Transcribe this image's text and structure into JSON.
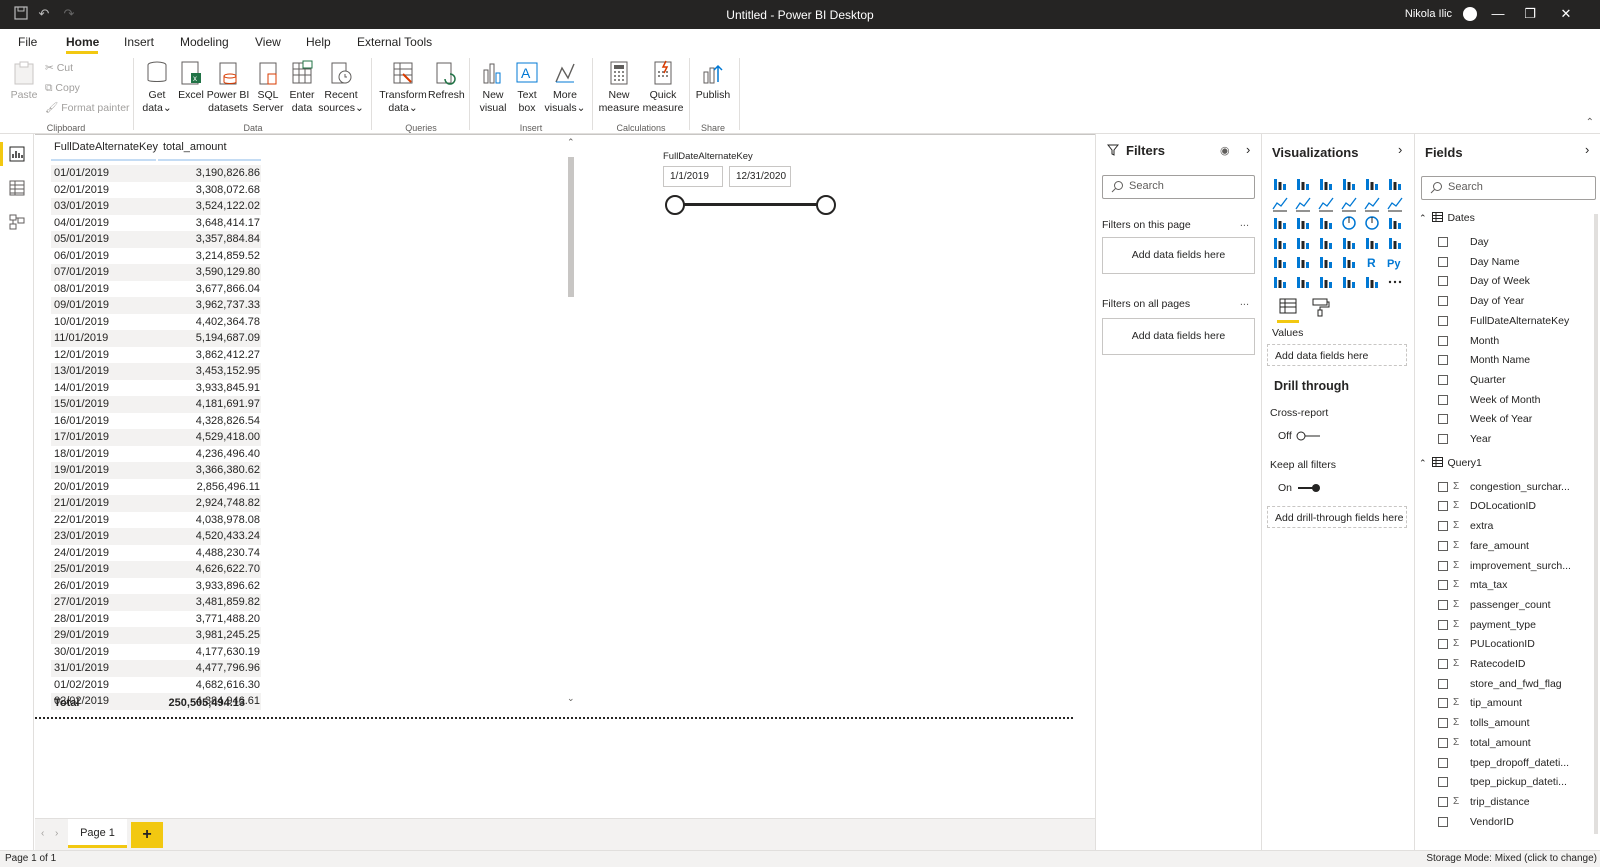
{
  "window": {
    "title": "Untitled - Power BI Desktop",
    "user": "Nikola Ilic"
  },
  "menu": {
    "items": [
      "File",
      "Home",
      "Insert",
      "Modeling",
      "View",
      "Help",
      "External Tools"
    ],
    "active": "Home"
  },
  "ribbon": {
    "clipboard": {
      "paste": "Paste",
      "cut": "Cut",
      "copy": "Copy",
      "format_painter": "Format painter",
      "label": "Clipboard"
    },
    "data": {
      "get_data_1": "Get",
      "get_data_2": "data",
      "excel": "Excel",
      "pbi_1": "Power BI",
      "pbi_2": "datasets",
      "sql_1": "SQL",
      "sql_2": "Server",
      "enter_1": "Enter",
      "enter_2": "data",
      "recent_1": "Recent",
      "recent_2": "sources",
      "label": "Data"
    },
    "queries": {
      "transform_1": "Transform",
      "transform_2": "data",
      "refresh": "Refresh",
      "label": "Queries"
    },
    "insert": {
      "new_visual_1": "New",
      "new_visual_2": "visual",
      "text_box_1": "Text",
      "text_box_2": "box",
      "more_1": "More",
      "more_2": "visuals",
      "label": "Insert"
    },
    "calculations": {
      "new_measure_1": "New",
      "new_measure_2": "measure",
      "quick_measure_1": "Quick",
      "quick_measure_2": "measure",
      "label": "Calculations"
    },
    "share": {
      "publish": "Publish",
      "label": "Share"
    }
  },
  "table": {
    "headers": [
      "FullDateAlternateKey",
      "total_amount"
    ],
    "rows": [
      [
        "01/01/2019",
        "3,190,826.86"
      ],
      [
        "02/01/2019",
        "3,308,072.68"
      ],
      [
        "03/01/2019",
        "3,524,122.02"
      ],
      [
        "04/01/2019",
        "3,648,414.17"
      ],
      [
        "05/01/2019",
        "3,357,884.84"
      ],
      [
        "06/01/2019",
        "3,214,859.52"
      ],
      [
        "07/01/2019",
        "3,590,129.80"
      ],
      [
        "08/01/2019",
        "3,677,866.04"
      ],
      [
        "09/01/2019",
        "3,962,737.33"
      ],
      [
        "10/01/2019",
        "4,402,364.78"
      ],
      [
        "11/01/2019",
        "5,194,687.09"
      ],
      [
        "12/01/2019",
        "3,862,412.27"
      ],
      [
        "13/01/2019",
        "3,453,152.95"
      ],
      [
        "14/01/2019",
        "3,933,845.91"
      ],
      [
        "15/01/2019",
        "4,181,691.97"
      ],
      [
        "16/01/2019",
        "4,328,826.54"
      ],
      [
        "17/01/2019",
        "4,529,418.00"
      ],
      [
        "18/01/2019",
        "4,236,496.40"
      ],
      [
        "19/01/2019",
        "3,366,380.62"
      ],
      [
        "20/01/2019",
        "2,856,496.11"
      ],
      [
        "21/01/2019",
        "2,924,748.82"
      ],
      [
        "22/01/2019",
        "4,038,978.08"
      ],
      [
        "23/01/2019",
        "4,520,433.24"
      ],
      [
        "24/01/2019",
        "4,488,230.74"
      ],
      [
        "25/01/2019",
        "4,626,622.70"
      ],
      [
        "26/01/2019",
        "3,933,896.62"
      ],
      [
        "27/01/2019",
        "3,481,859.82"
      ],
      [
        "28/01/2019",
        "3,771,488.20"
      ],
      [
        "29/01/2019",
        "3,981,245.25"
      ],
      [
        "30/01/2019",
        "4,177,630.19"
      ],
      [
        "31/01/2019",
        "4,477,796.96"
      ],
      [
        "01/02/2019",
        "4,682,616.30"
      ],
      [
        "02/02/2019",
        "4,384,946.61"
      ]
    ],
    "total_label": "Total",
    "total_value": "250,505,494.13"
  },
  "slicer": {
    "title": "FullDateAlternateKey",
    "start": "1/1/2019",
    "end": "12/31/2020"
  },
  "pages": {
    "tab": "Page 1",
    "add": "+"
  },
  "status": {
    "left": "Page 1 of 1",
    "right": "Storage Mode: Mixed (click to change)"
  },
  "filters": {
    "title": "Filters",
    "search_placeholder": "Search",
    "on_this_page": "Filters on this page",
    "on_all_pages": "Filters on all pages",
    "add_fields": "Add data fields here",
    "more": "..."
  },
  "visualizations": {
    "title": "Visualizations",
    "values_label": "Values",
    "values_drop": "Add data fields here",
    "drill_title": "Drill through",
    "cross_report": "Cross-report",
    "cross_state": "Off",
    "keep_filters": "Keep all filters",
    "keep_state": "On",
    "drill_drop": "Add drill-through fields here",
    "more": "..."
  },
  "fields": {
    "title": "Fields",
    "search_placeholder": "Search",
    "tables": [
      {
        "name": "Dates",
        "fields": [
          {
            "name": "Day",
            "sigma": false
          },
          {
            "name": "Day Name",
            "sigma": false
          },
          {
            "name": "Day of Week",
            "sigma": false
          },
          {
            "name": "Day of Year",
            "sigma": false
          },
          {
            "name": "FullDateAlternateKey",
            "sigma": false
          },
          {
            "name": "Month",
            "sigma": false
          },
          {
            "name": "Month Name",
            "sigma": false
          },
          {
            "name": "Quarter",
            "sigma": false
          },
          {
            "name": "Week of Month",
            "sigma": false
          },
          {
            "name": "Week of Year",
            "sigma": false
          },
          {
            "name": "Year",
            "sigma": false
          }
        ]
      },
      {
        "name": "Query1",
        "fields": [
          {
            "name": "congestion_surchar...",
            "sigma": true
          },
          {
            "name": "DOLocationID",
            "sigma": true
          },
          {
            "name": "extra",
            "sigma": true
          },
          {
            "name": "fare_amount",
            "sigma": true
          },
          {
            "name": "improvement_surch...",
            "sigma": true
          },
          {
            "name": "mta_tax",
            "sigma": true
          },
          {
            "name": "passenger_count",
            "sigma": true
          },
          {
            "name": "payment_type",
            "sigma": true
          },
          {
            "name": "PULocationID",
            "sigma": true
          },
          {
            "name": "RatecodeID",
            "sigma": true
          },
          {
            "name": "store_and_fwd_flag",
            "sigma": false
          },
          {
            "name": "tip_amount",
            "sigma": true
          },
          {
            "name": "tolls_amount",
            "sigma": true
          },
          {
            "name": "total_amount",
            "sigma": true
          },
          {
            "name": "tpep_dropoff_dateti...",
            "sigma": false
          },
          {
            "name": "tpep_pickup_dateti...",
            "sigma": false
          },
          {
            "name": "trip_distance",
            "sigma": true
          },
          {
            "name": "VendorID",
            "sigma": false
          }
        ]
      }
    ]
  },
  "colors": {
    "accent": "#F2C811",
    "titlebar": "#252423"
  }
}
